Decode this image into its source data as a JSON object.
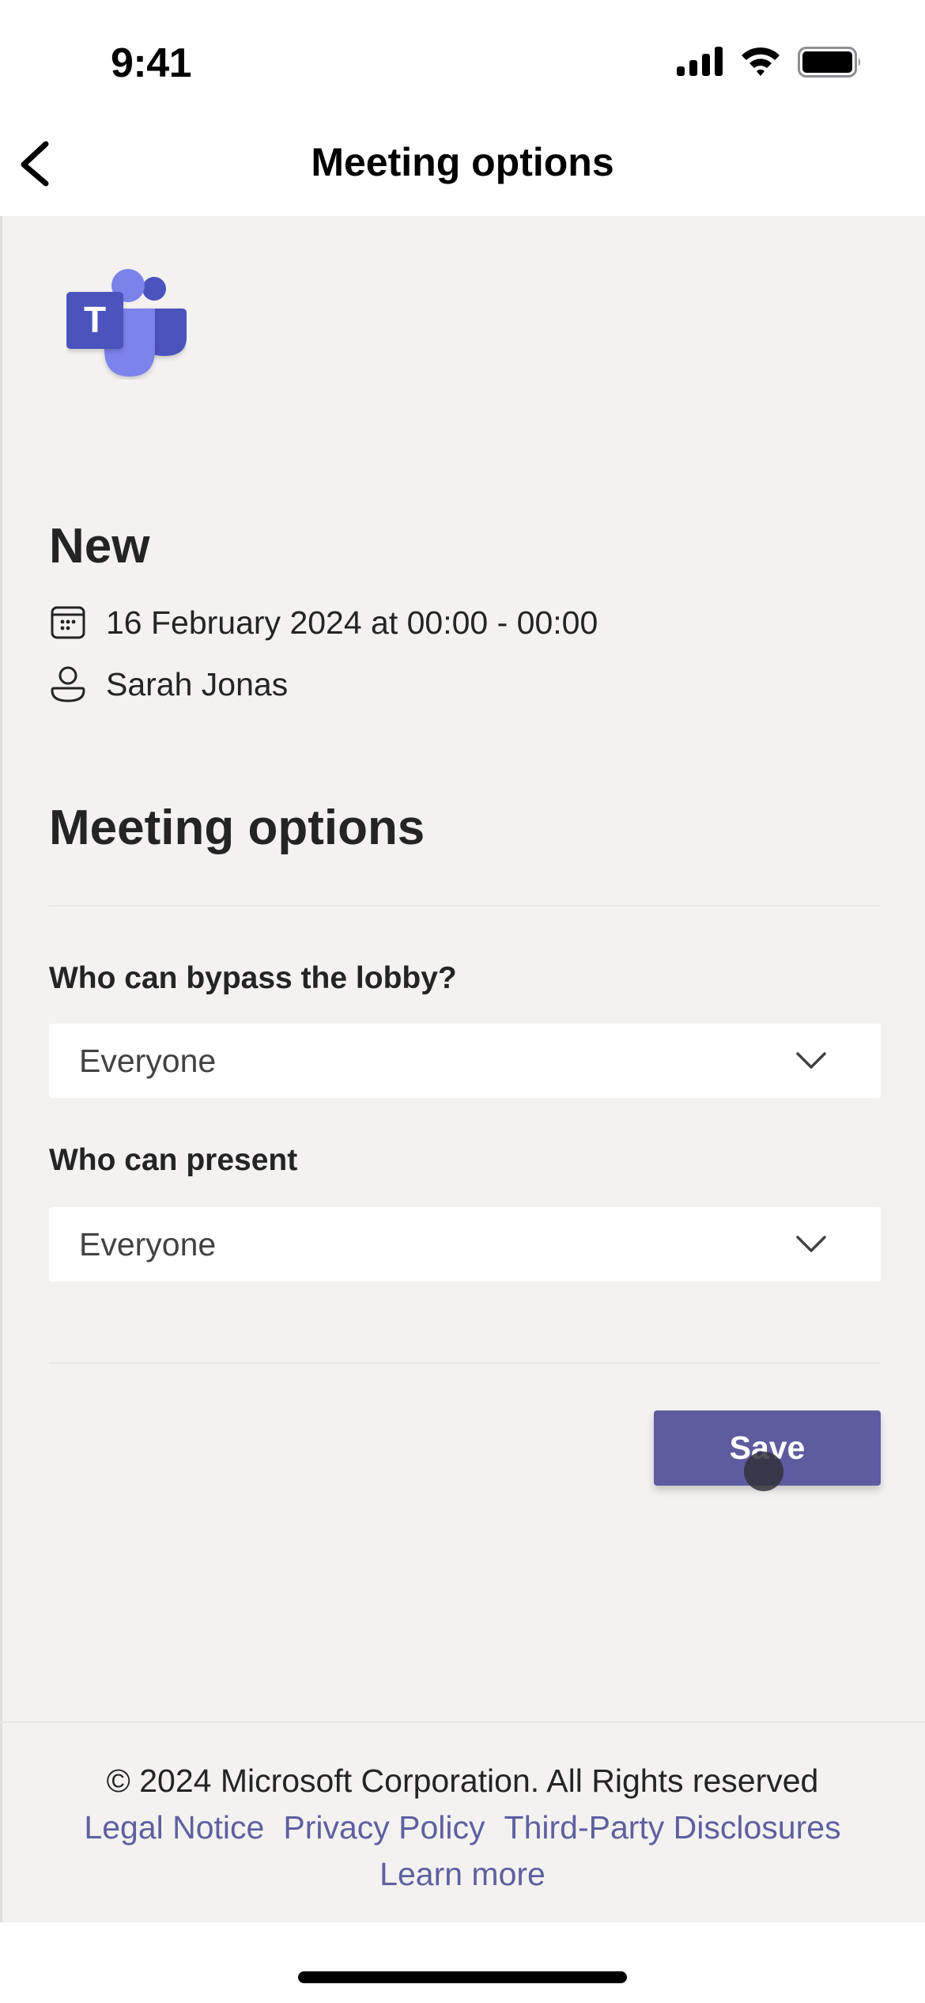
{
  "status_bar": {
    "time": "9:41",
    "icons": [
      "signal-icon",
      "wifi-icon",
      "battery-icon"
    ]
  },
  "nav": {
    "back_icon": "chevron-left-icon",
    "title": "Meeting options"
  },
  "app_logo": "microsoft-teams-logo",
  "meeting": {
    "title": "New",
    "datetime": "16 February 2024 at 00:00 - 00:00",
    "datetime_icon": "calendar-icon",
    "organizer": "Sarah Jonas",
    "organizer_icon": "person-icon"
  },
  "options": {
    "section_title": "Meeting options",
    "fields": [
      {
        "label": "Who can bypass the lobby?",
        "value": "Everyone",
        "icon": "chevron-down-icon"
      },
      {
        "label": "Who can present",
        "value": "Everyone",
        "icon": "chevron-down-icon"
      }
    ],
    "save_label": "Save"
  },
  "footer": {
    "copyright": "© 2024 Microsoft Corporation. All Rights reserved",
    "links": [
      "Legal Notice",
      "Privacy Policy",
      "Third-Party Disclosures"
    ],
    "learn_more": "Learn more"
  },
  "colors": {
    "accent": "#5f5b9f",
    "link": "#5f5f9f",
    "background": "#f3f2f1",
    "text": "#242424"
  }
}
